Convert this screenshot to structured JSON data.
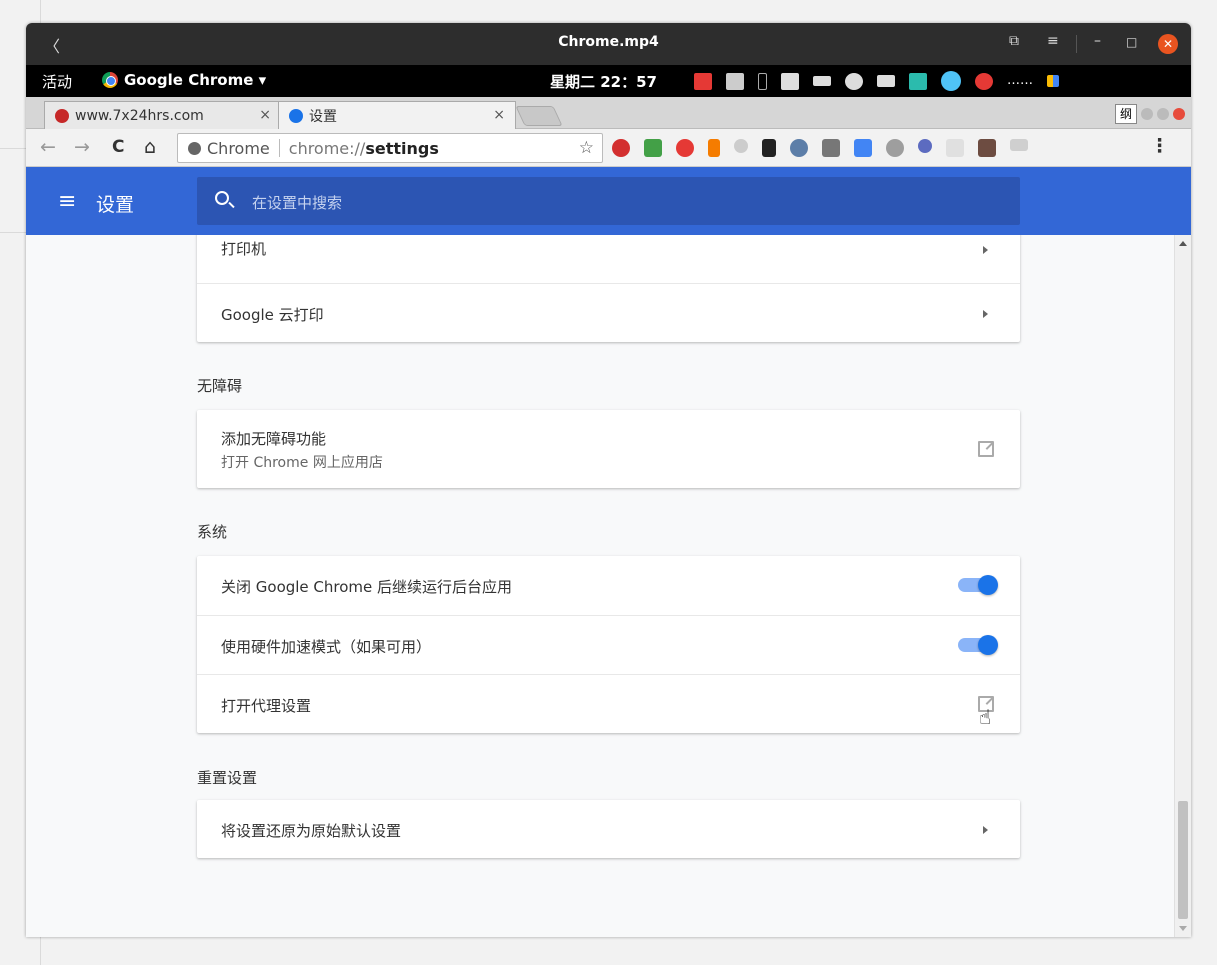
{
  "player": {
    "title": "Chrome.mp4",
    "back_glyph": "〈",
    "restore_glyph": "⧉",
    "menu_glyph": "≡",
    "minimize_glyph": "–",
    "maximize_glyph": "□",
    "close_glyph": "✕"
  },
  "topbar": {
    "activities": "活动",
    "app_name": "Google Chrome ▾",
    "clock": "星期二 22：57",
    "tray_more": "……"
  },
  "tabs": [
    {
      "title": "www.7x24hrs.com",
      "close": "×"
    },
    {
      "title": "设置",
      "close": "×"
    }
  ],
  "ime_label": "纲",
  "toolbar": {
    "back": "←",
    "forward": "→",
    "reload": "C",
    "home": "⌂",
    "site_label": "Chrome",
    "url_scheme": "chrome://",
    "url_path": "settings",
    "star": "☆",
    "menu": "⋮"
  },
  "settings": {
    "header_title": "设置",
    "menu_glyph": "≡",
    "search_placeholder": "在设置中搜索",
    "printing_rows": [
      {
        "label": "打印机"
      },
      {
        "label": "Google 云打印"
      }
    ],
    "accessibility": {
      "heading": "无障碍",
      "row_title": "添加无障碍功能",
      "row_subtitle": "打开 Chrome 网上应用店"
    },
    "system": {
      "heading": "系统",
      "rows": [
        {
          "label": "关闭 Google Chrome 后继续运行后台应用",
          "enabled": true
        },
        {
          "label": "使用硬件加速模式（如果可用）",
          "enabled": true
        },
        {
          "label": "打开代理设置"
        }
      ]
    },
    "reset": {
      "heading": "重置设置",
      "row_label": "将设置还原为原始默认设置"
    }
  },
  "colors": {
    "header_blue": "#3367d6",
    "toggle_knob": "#1a73e8",
    "toggle_track": "#8ab4f8",
    "ubuntu_orange": "#e95420"
  },
  "cursor_glyph": "☝"
}
